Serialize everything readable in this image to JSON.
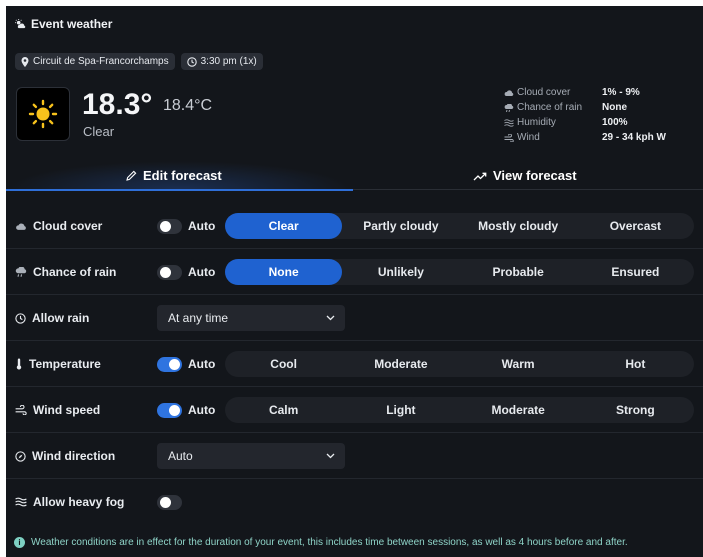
{
  "header": {
    "title": "Event weather",
    "icon": "sun-cloud-icon",
    "track": "Circuit de Spa-Francorchamps",
    "time": "3:30 pm (1x)"
  },
  "current": {
    "temp_primary": "18.3°",
    "temp_secondary": "18.4°C",
    "condition": "Clear",
    "icon": "sun-icon"
  },
  "stats": [
    {
      "label": "Cloud cover",
      "value": "1% - 9%",
      "icon": "cloud-icon"
    },
    {
      "label": "Chance of rain",
      "value": "None",
      "icon": "rain-cloud-icon"
    },
    {
      "label": "Humidity",
      "value": "100%",
      "icon": "humidity-icon"
    },
    {
      "label": "Wind",
      "value": "29 - 34 kph W",
      "icon": "wind-icon"
    }
  ],
  "tabs": {
    "edit": "Edit forecast",
    "view": "View forecast",
    "active": "edit"
  },
  "rows": {
    "cloud_cover": {
      "label": "Cloud cover",
      "auto": "Auto",
      "auto_on": false,
      "options": [
        "Clear",
        "Partly cloudy",
        "Mostly cloudy",
        "Overcast"
      ],
      "selected": "Clear"
    },
    "chance_of_rain": {
      "label": "Chance of rain",
      "auto": "Auto",
      "auto_on": false,
      "options": [
        "None",
        "Unlikely",
        "Probable",
        "Ensured"
      ],
      "selected": "None"
    },
    "allow_rain": {
      "label": "Allow rain",
      "value": "At any time"
    },
    "temperature": {
      "label": "Temperature",
      "auto": "Auto",
      "auto_on": true,
      "options": [
        "Cool",
        "Moderate",
        "Warm",
        "Hot"
      ],
      "selected": ""
    },
    "wind_speed": {
      "label": "Wind speed",
      "auto": "Auto",
      "auto_on": true,
      "options": [
        "Calm",
        "Light",
        "Moderate",
        "Strong"
      ],
      "selected": ""
    },
    "wind_direction": {
      "label": "Wind direction",
      "value": "Auto"
    },
    "heavy_fog": {
      "label": "Allow heavy fog",
      "on": false
    }
  },
  "footer": {
    "note": "Weather conditions are in effect for the duration of your event, this includes time between sessions, as well as 4 hours before and after."
  },
  "colors": {
    "accent": "#1f62d0",
    "background": "#13161b",
    "footer_text": "#8fd4c8"
  }
}
